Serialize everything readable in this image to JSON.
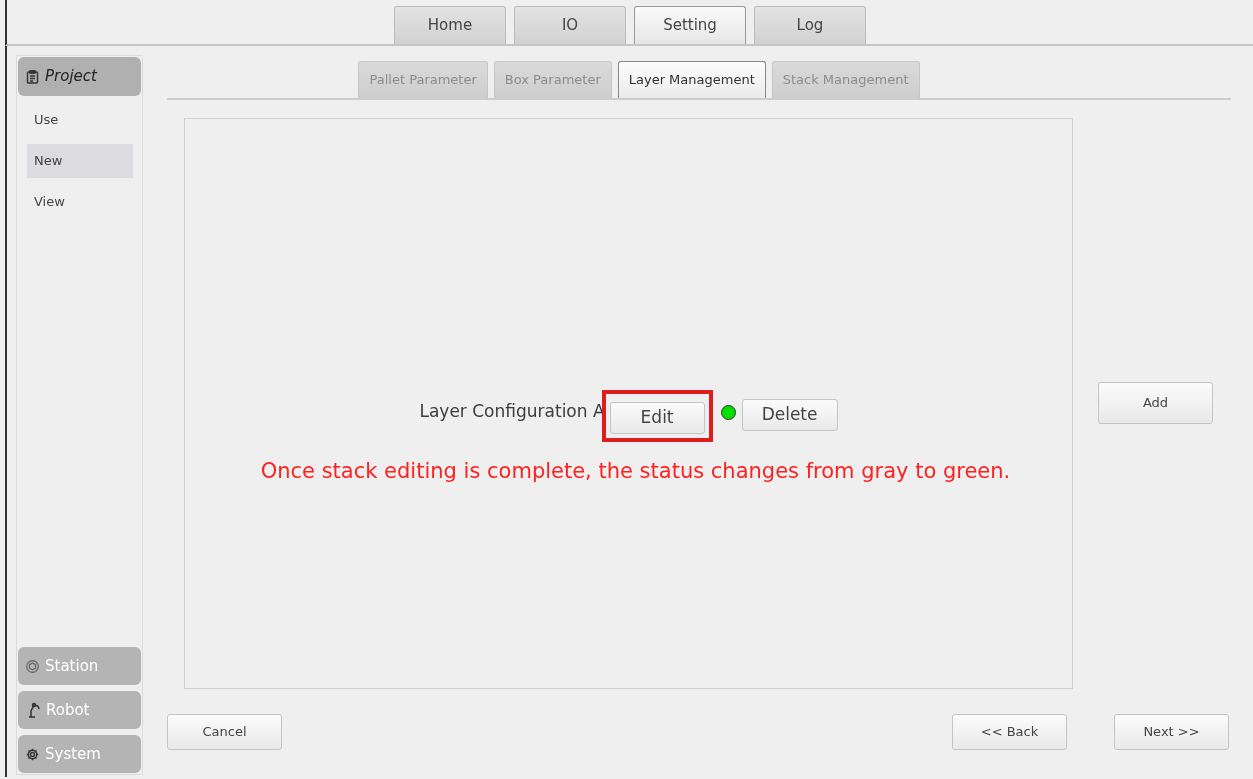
{
  "top_tabs": [
    {
      "label": "Home",
      "selected": false
    },
    {
      "label": "IO",
      "selected": false
    },
    {
      "label": "Setting",
      "selected": true
    },
    {
      "label": "Log",
      "selected": false
    }
  ],
  "sidebar": {
    "header": {
      "label": "Project"
    },
    "items": [
      {
        "label": "Use",
        "selected": false
      },
      {
        "label": "New",
        "selected": true
      },
      {
        "label": "View",
        "selected": false
      }
    ],
    "sections": [
      {
        "label": "Station"
      },
      {
        "label": "Robot"
      },
      {
        "label": "System"
      }
    ]
  },
  "sub_tabs": [
    {
      "label": "Pallet Parameter",
      "selected": false,
      "disabled": true
    },
    {
      "label": "Box Parameter",
      "selected": false,
      "disabled": true
    },
    {
      "label": "Layer Management",
      "selected": true,
      "disabled": false
    },
    {
      "label": "Stack Management",
      "selected": false,
      "disabled": true
    }
  ],
  "layers": [
    {
      "name": "Layer Configuration A",
      "edit": "Edit",
      "edit_highlighted": true,
      "complete": true,
      "delete": "Delete"
    }
  ],
  "note": "Once stack editing is complete, the status changes from gray to green.",
  "add_button": "Add",
  "buttons": {
    "cancel": "Cancel",
    "back": "<< Back",
    "next": "Next >>"
  }
}
